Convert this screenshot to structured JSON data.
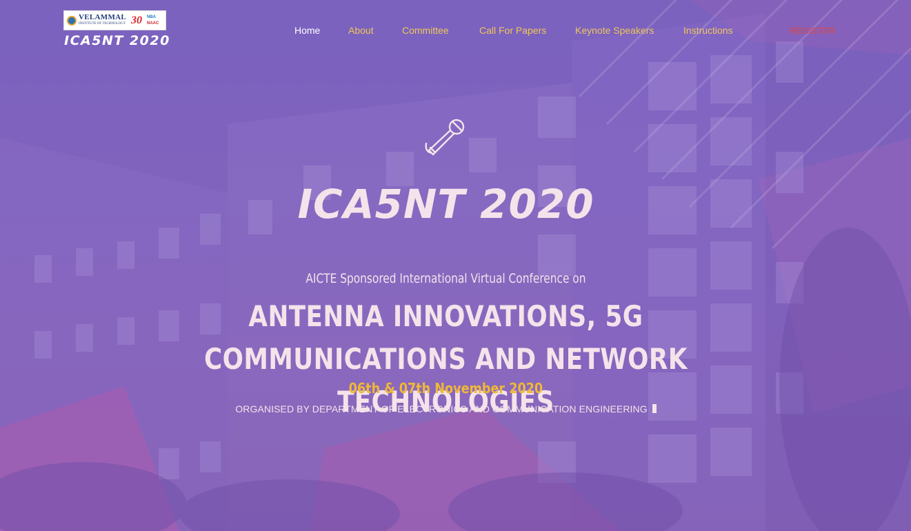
{
  "header": {
    "logo": {
      "institute_name": "VELAMMAL",
      "institute_sub": "INSTITUTE OF TECHNOLOGY",
      "anniversary": "30",
      "badge_nba": "NBA",
      "badge_naac": "NAAC"
    },
    "site_title": "ICA5NT 2020"
  },
  "nav": {
    "items": [
      {
        "label": "Home",
        "color": "#ffffff"
      },
      {
        "label": "About",
        "color": "#f0c65b"
      },
      {
        "label": "Committee",
        "color": "#f0c65b"
      },
      {
        "label": "Call For Papers",
        "color": "#f0c65b"
      },
      {
        "label": "Keynote Speakers",
        "color": "#f0c65b"
      },
      {
        "label": "Instructions",
        "color": "#f0c65b"
      }
    ],
    "register": {
      "label": "REGISTER",
      "color": "#e0453f"
    }
  },
  "hero": {
    "icon": "microphone-icon",
    "title": "ICA5NT 2020",
    "subtitle": "AICTE Sponsored International Virtual Conference on",
    "theme_line1": "ANTENNA INNOVATIONS, 5G COMMUNICATIONS AND NETWORK",
    "theme_line2": "TECHNOLOGIES",
    "date": "06th & 07th November 2020",
    "organiser": "ORGANISED BY DEPARTMENT OF ELECTRONICS AND COMMUNICATION ENGINEERING"
  },
  "colors": {
    "overlay": "#7a5fb8",
    "text_light": "#f4e3ea",
    "accent_gold": "#f0b836",
    "accent_red": "#e0453f"
  }
}
